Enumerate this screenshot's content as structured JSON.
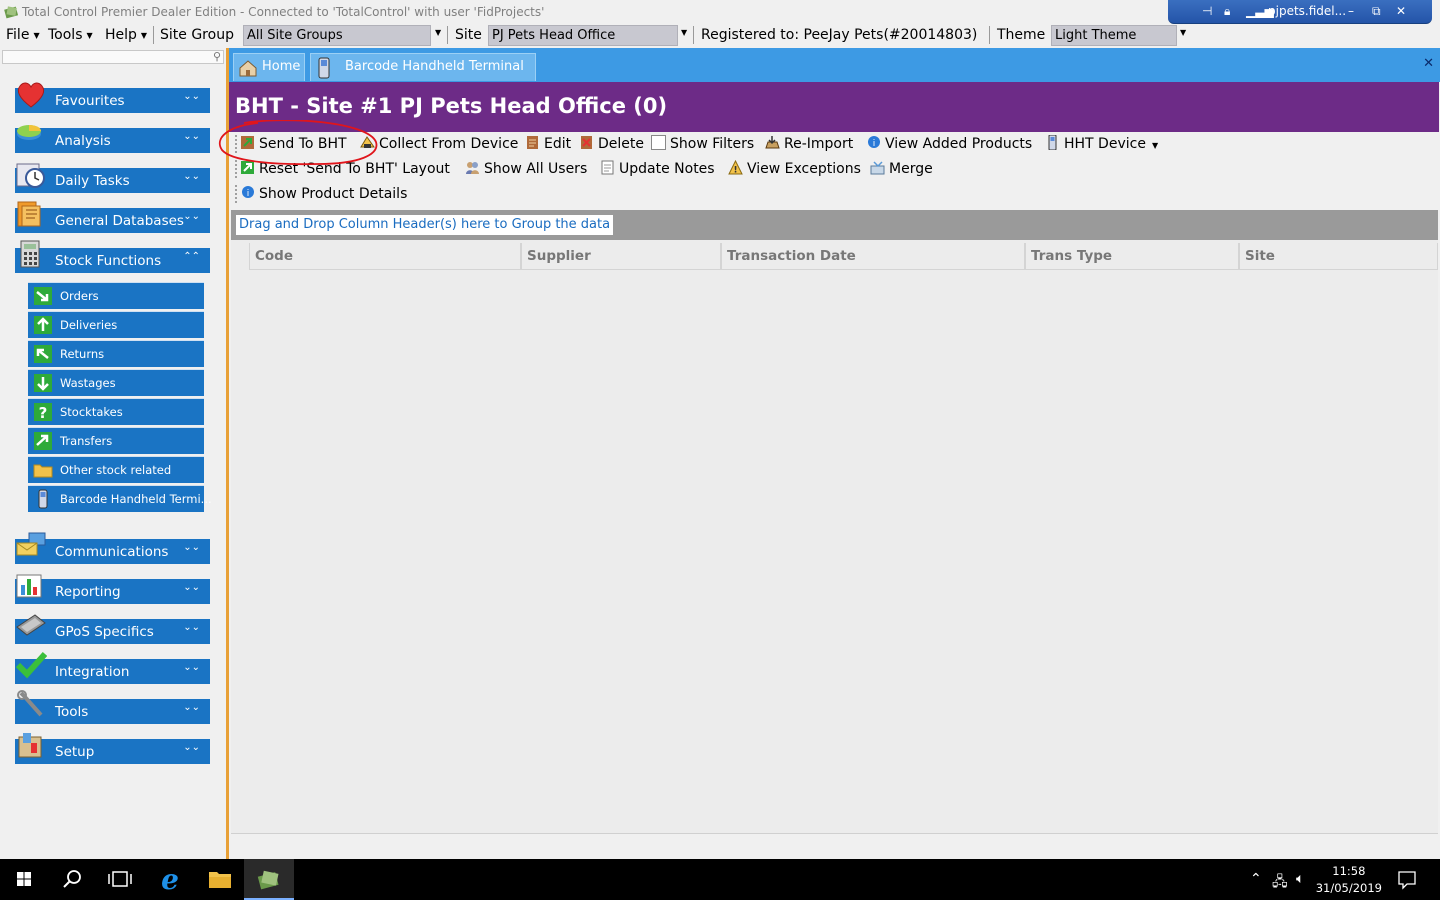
{
  "window": {
    "title": "Total Control Premier Dealer Edition - Connected to 'TotalControl' with user 'FidProjects'",
    "rdp_host": "pjpets.fidel..."
  },
  "menubar": {
    "file": "File",
    "tools": "Tools",
    "help": "Help",
    "site_group_label": "Site Group",
    "site_group_value": "All Site Groups",
    "site_label": "Site",
    "site_value": "PJ Pets Head Office",
    "registered": "Registered to: PeeJay Pets(#20014803)",
    "theme_label": "Theme",
    "theme_value": "Light Theme"
  },
  "sidebar": {
    "sections_top": [
      {
        "label": "Favourites",
        "icon": "heart-icon"
      },
      {
        "label": "Analysis",
        "icon": "analysis-icon"
      },
      {
        "label": "Daily Tasks",
        "icon": "clock-icon"
      },
      {
        "label": "General Databases",
        "icon": "databases-icon"
      },
      {
        "label": "Stock Functions",
        "icon": "calculator-icon"
      }
    ],
    "stock_items": [
      {
        "label": "Orders",
        "icon": "orders-icon"
      },
      {
        "label": "Deliveries",
        "icon": "deliveries-icon"
      },
      {
        "label": "Returns",
        "icon": "returns-icon"
      },
      {
        "label": "Wastages",
        "icon": "wastages-icon"
      },
      {
        "label": "Stocktakes",
        "icon": "stocktakes-icon"
      },
      {
        "label": "Transfers",
        "icon": "transfers-icon"
      },
      {
        "label": "Other stock related",
        "icon": "folder-icon"
      },
      {
        "label": "Barcode Handheld Termi...",
        "icon": "handheld-icon"
      }
    ],
    "sections_bottom": [
      {
        "label": "Communications",
        "icon": "communications-icon"
      },
      {
        "label": "Reporting",
        "icon": "reporting-icon"
      },
      {
        "label": "GPoS Specifics",
        "icon": "gpos-icon"
      },
      {
        "label": "Integration",
        "icon": "checkmark-icon"
      },
      {
        "label": "Tools",
        "icon": "wrench-icon"
      },
      {
        "label": "Setup",
        "icon": "setup-icon"
      }
    ]
  },
  "tabs": [
    {
      "label": "Home"
    },
    {
      "label": "Barcode Handheld Terminal"
    }
  ],
  "header": {
    "title": "BHT - Site #1 PJ Pets Head Office (0)"
  },
  "toolbar": {
    "send_to_bht": "Send To BHT",
    "collect_from_device": "Collect From Device",
    "edit": "Edit",
    "delete": "Delete",
    "show_filters": "Show Filters",
    "re_import": "Re-Import",
    "view_added_products": "View Added Products",
    "hht_device": "HHT Device",
    "reset_layout": "Reset 'Send To BHT' Layout",
    "show_all_users": "Show All Users",
    "update_notes": "Update Notes",
    "view_exceptions": "View Exceptions",
    "merge": "Merge",
    "show_product_details": "Show Product Details"
  },
  "grid": {
    "group_hint": "Drag and Drop Column Header(s) here to Group the data",
    "columns": [
      "Code",
      "Supplier",
      "Transaction Date",
      "Trans Type",
      "Site"
    ]
  },
  "taskbar": {
    "time": "11:58",
    "date": "31/05/2019"
  },
  "colors": {
    "nav_blue": "#1a74c4",
    "header_purple": "#6d2b87",
    "tab_blue": "#3d9ae4",
    "divider_orange": "#e8a036",
    "annotation_red": "#e0151b"
  }
}
